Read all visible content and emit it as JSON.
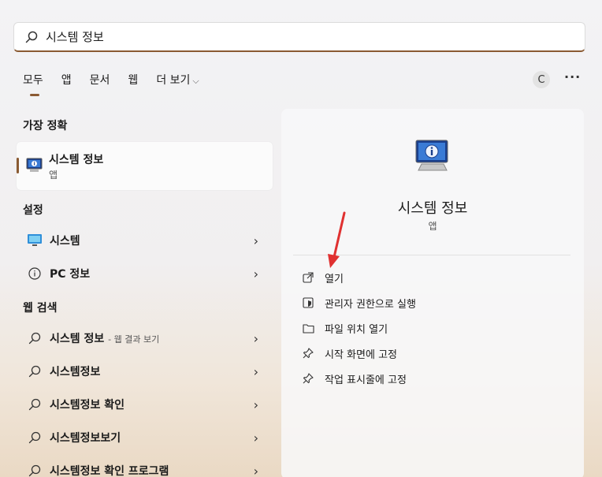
{
  "search": {
    "value": "시스템 정보"
  },
  "tabs": [
    {
      "label": "모두"
    },
    {
      "label": "앱"
    },
    {
      "label": "문서"
    },
    {
      "label": "웹"
    },
    {
      "label": "더 보기"
    }
  ],
  "header": {
    "avatar_initial": "C",
    "more_label": "···"
  },
  "best_match": {
    "heading": "가장 정확",
    "name": "시스템 정보",
    "type": "앱"
  },
  "settings": {
    "heading": "설정",
    "items": [
      {
        "label": "시스템"
      },
      {
        "label": "PC 정보"
      }
    ]
  },
  "web_search": {
    "heading": "웹 검색",
    "items": [
      {
        "label": "시스템 정보",
        "note": "- 웹 결과 보기"
      },
      {
        "label": "시스템정보"
      },
      {
        "label": "시스템정보 확인"
      },
      {
        "label": "시스템정보보기"
      },
      {
        "label": "시스템정보 확인 프로그램"
      }
    ]
  },
  "detail": {
    "title": "시스템 정보",
    "type": "앱",
    "actions": [
      {
        "label": "열기"
      },
      {
        "label": "관리자 권한으로 실행"
      },
      {
        "label": "파일 위치 열기"
      },
      {
        "label": "시작 화면에 고정"
      },
      {
        "label": "작업 표시줄에 고정"
      }
    ]
  },
  "colors": {
    "accent": "#8a5a32",
    "annotation_arrow": "#e03131"
  }
}
